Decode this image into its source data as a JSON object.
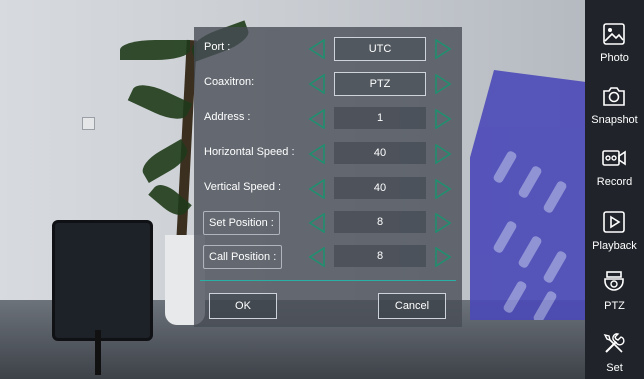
{
  "dialog": {
    "rows": [
      {
        "label": "Port :",
        "value": "UTC"
      },
      {
        "label": "Coaxitron:",
        "value": "PTZ"
      },
      {
        "label": "Address :",
        "value": "1"
      },
      {
        "label": "Horizontal Speed :",
        "value": "40"
      },
      {
        "label": "Vertical Speed :",
        "value": "40"
      },
      {
        "label": "Set Position :",
        "value": "8"
      },
      {
        "label": "Call Position :",
        "value": "8"
      }
    ],
    "ok_label": "OK",
    "cancel_label": "Cancel"
  },
  "toolbar": {
    "items": [
      {
        "label": "Photo",
        "icon": "photo-icon"
      },
      {
        "label": "Snapshot",
        "icon": "camera-icon"
      },
      {
        "label": "Record",
        "icon": "record-icon"
      },
      {
        "label": "Playback",
        "icon": "playback-icon"
      },
      {
        "label": "PTZ",
        "icon": "ptz-camera-icon"
      },
      {
        "label": "Set",
        "icon": "tools-icon"
      }
    ]
  },
  "colors": {
    "accent_teal": "#28b0a4",
    "arrow_green": "#1f8f6f",
    "toolbar_bg": "#20242a"
  }
}
